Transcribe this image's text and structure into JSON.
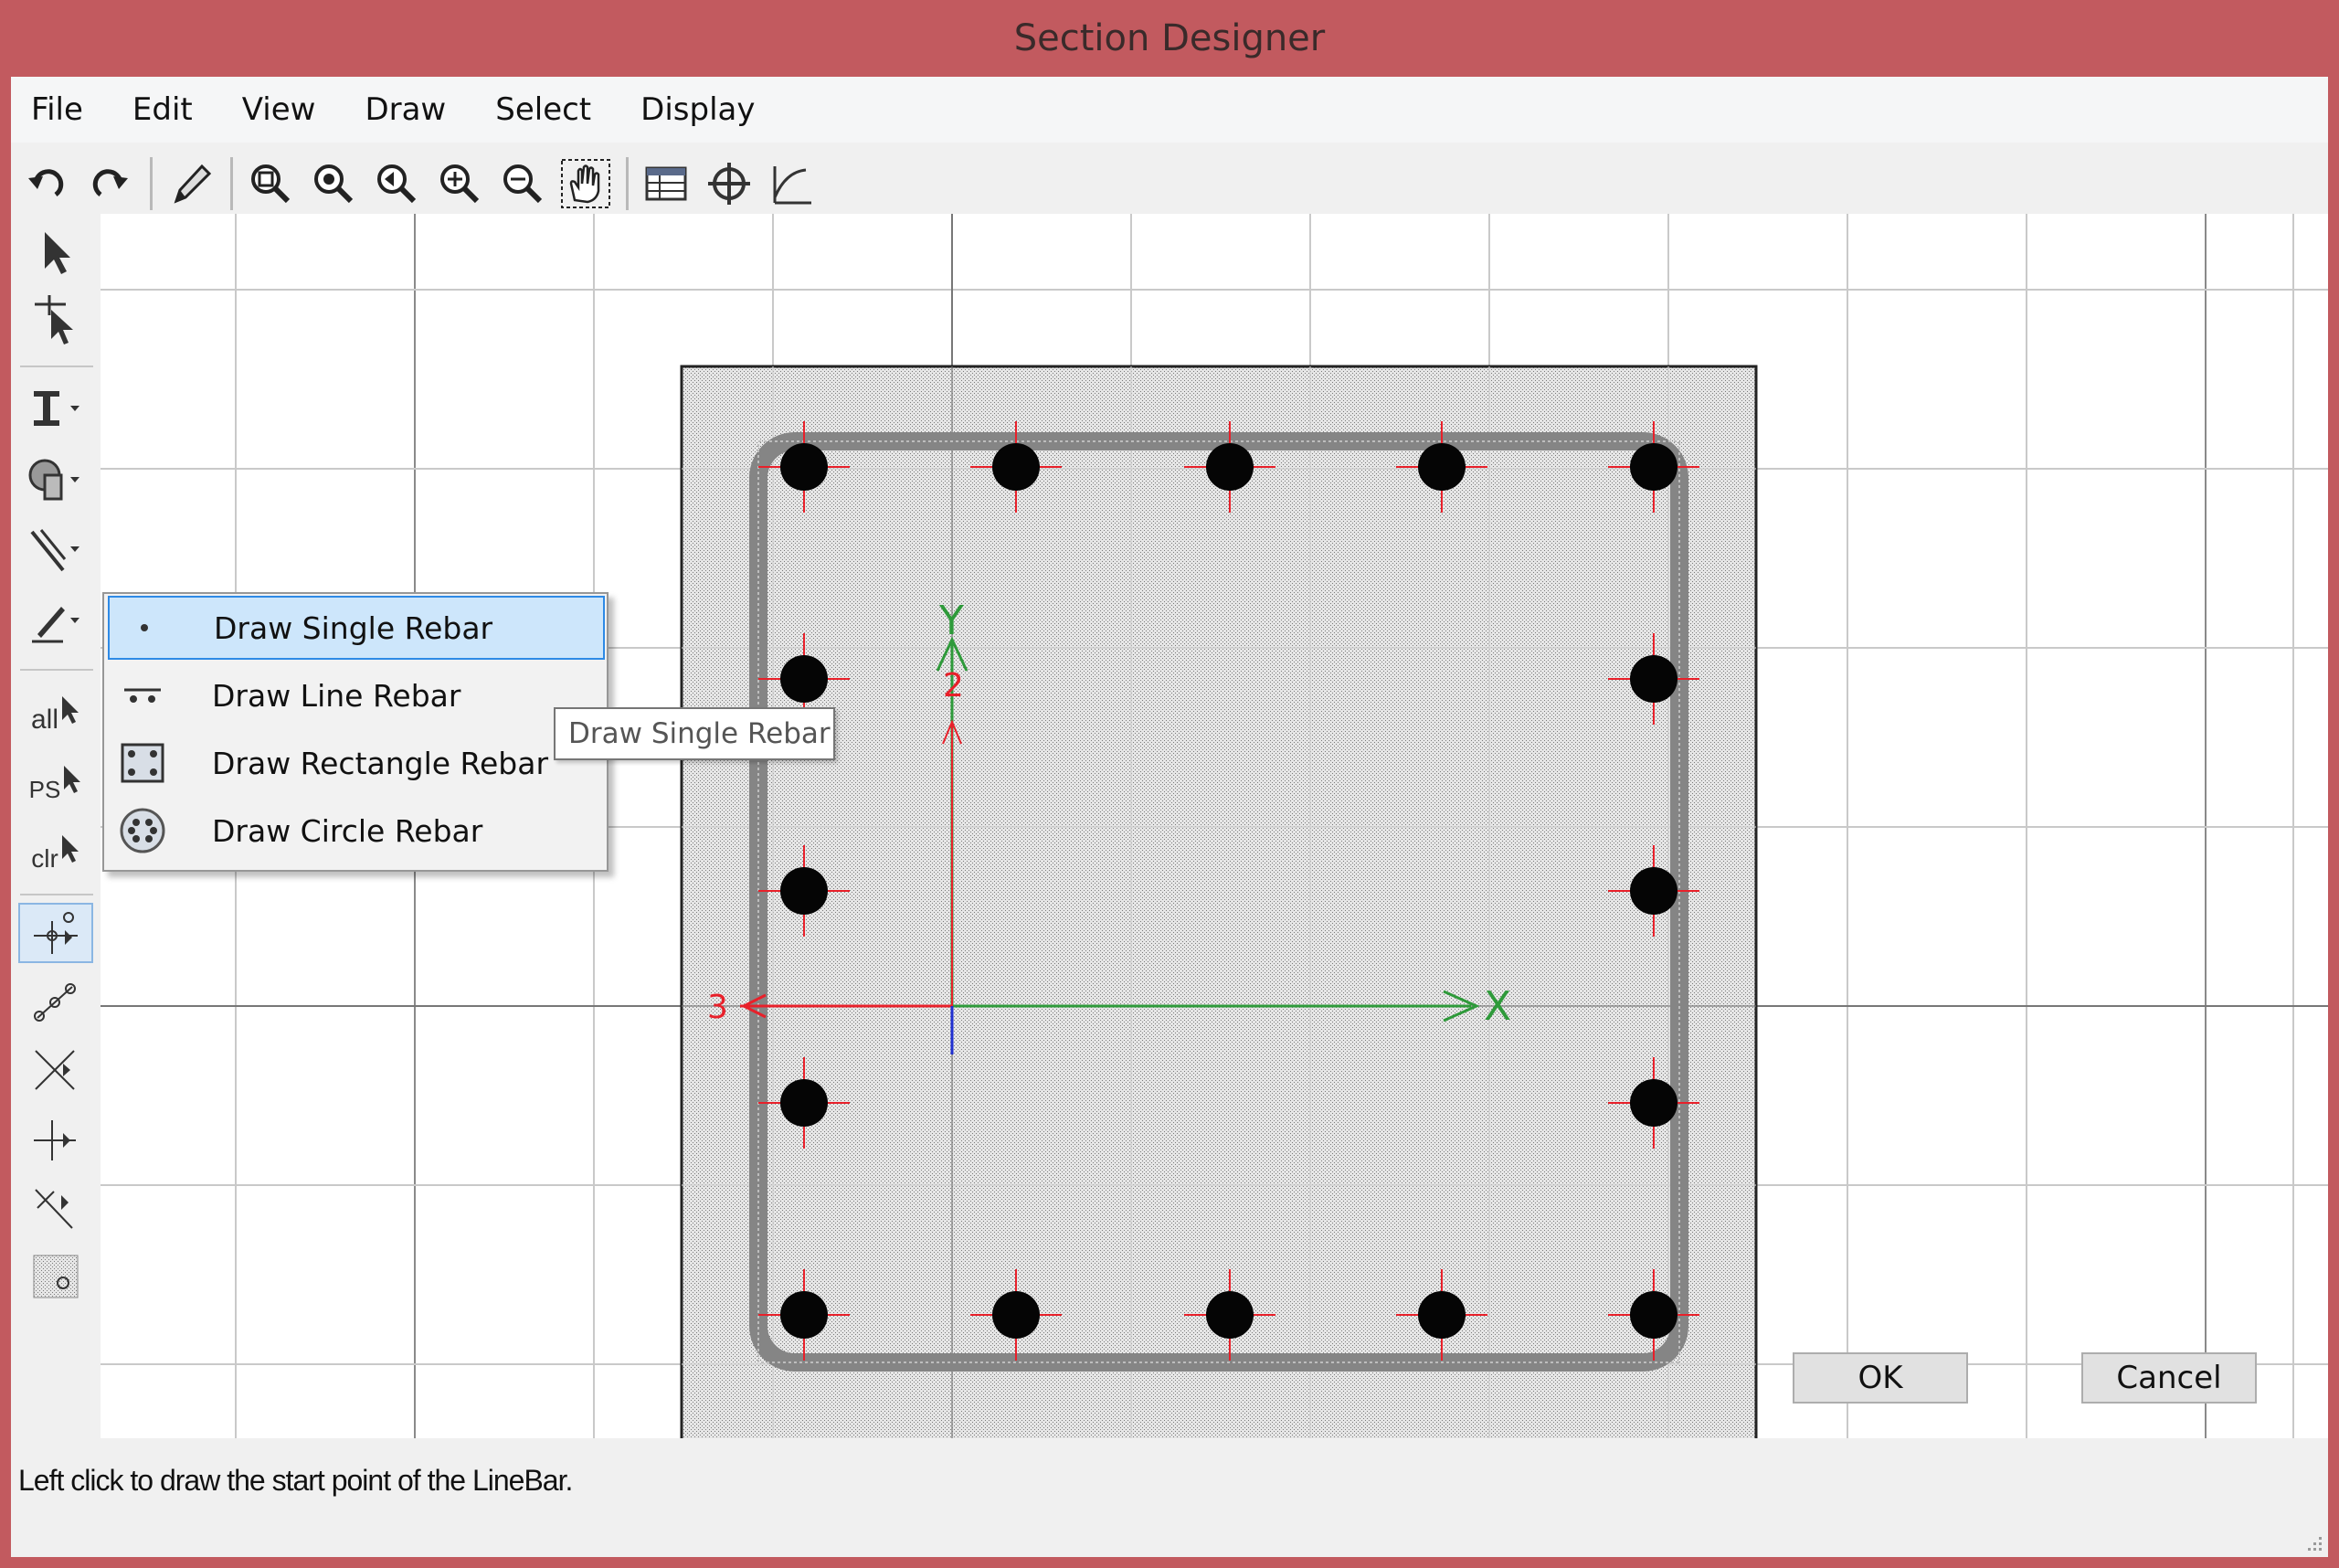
{
  "window": {
    "title": "Section Designer"
  },
  "menu": [
    "File",
    "Edit",
    "View",
    "Draw",
    "Select",
    "Display"
  ],
  "toolbar_icons": [
    "undo-icon",
    "redo-icon",
    "pencil-icon",
    "zoom-window-icon",
    "zoom-restore-icon",
    "zoom-previous-icon",
    "zoom-in-icon",
    "zoom-out-icon",
    "pan-icon",
    "table-icon",
    "crosshair-icon",
    "axes-icon"
  ],
  "popup": {
    "items": [
      {
        "label": "Draw Single Rebar",
        "icon": "single-rebar-icon",
        "selected": true
      },
      {
        "label": "Draw Line Rebar",
        "icon": "line-rebar-icon",
        "selected": false
      },
      {
        "label": "Draw Rectangle Rebar",
        "icon": "rectangle-rebar-icon",
        "selected": false
      },
      {
        "label": "Draw Circle Rebar",
        "icon": "circle-rebar-icon",
        "selected": false
      }
    ]
  },
  "tooltip": "Draw Single Rebar",
  "left_tools": {
    "all": "all",
    "ps": "PS",
    "clr": "clr"
  },
  "axes": {
    "x": "X",
    "y": "Y",
    "label2": "2",
    "label3": "3"
  },
  "status": {
    "message": "Left click to draw the start point of the LineBar."
  },
  "buttons": {
    "ok": "OK",
    "cancel": "Cancel"
  },
  "colors": {
    "titlebar": "#c25a5f",
    "selection": "#cde6fb",
    "rebar_cross": "#e8202a",
    "axis_green": "#2e9a3a",
    "axis_red": "#e8202a",
    "axis_blue": "#2030d0"
  }
}
